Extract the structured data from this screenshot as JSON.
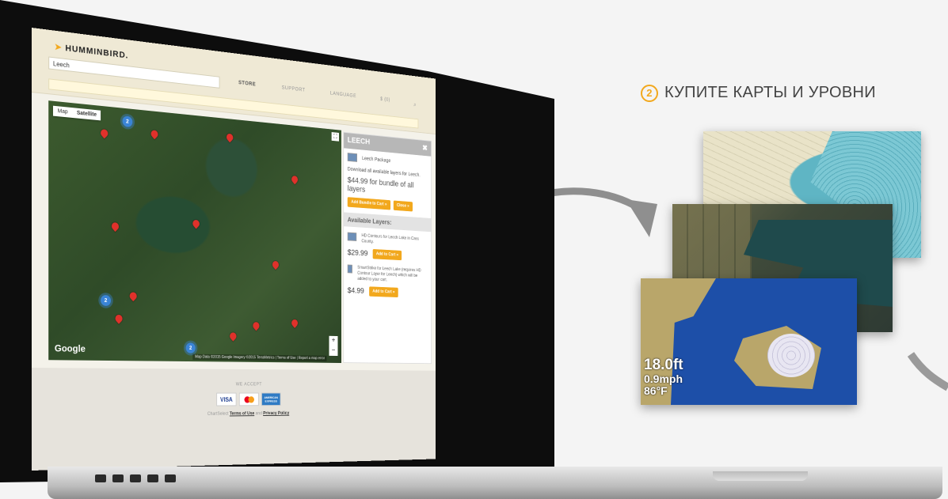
{
  "caption": {
    "number": "2",
    "text": "КУПИТЕ КАРТЫ И УРОВНИ"
  },
  "site": {
    "logo": "HUMMINBIRD.",
    "search_value": "Leech",
    "nav": [
      "STORE",
      "SUPPORT",
      "LANGUAGE",
      "$ (0)"
    ],
    "nav_search_icon": "search-icon"
  },
  "map": {
    "tabs": [
      "Map",
      "Satellite"
    ],
    "google": "Google",
    "attribution": "Map Data ©2015 Google Imagery ©2015 TerraMetrics | Terms of Use | Report a map error",
    "clusters": [
      "2",
      "2",
      "2"
    ]
  },
  "panel": {
    "title": "LEECH",
    "close_glyph": "✖",
    "package_label": "Leech Package",
    "download_text": "Download all available layers for Leech.",
    "bundle_price": "$44.99 for bundle of all layers",
    "add_bundle": "Add Bundle to Cart »",
    "close_btn": "Close »",
    "available_heading": "Available Layers:",
    "layers": [
      {
        "desc": "HD Contours for Leech Lake in Cass County.",
        "price": "$29.99",
        "button": "Add to Cart »"
      },
      {
        "desc": "SmartStrike for Leech Lake (requires HD Contour Layer for Leech) which will be added to your cart.",
        "price": "$4.99",
        "button": "Add to Cart »"
      }
    ]
  },
  "footer": {
    "we_accept": "WE ACCEPT",
    "cards": [
      "VISA",
      "MasterCard",
      "AMERICAN EXPRESS"
    ],
    "legal_prefix": "ChartSelect",
    "terms": "Terms of Use",
    "and": "and",
    "privacy": "Privacy Policy"
  },
  "chart_card": {
    "depth": "18.0ft",
    "speed": "0.9mph",
    "temp": "86°F"
  },
  "colors": {
    "accent": "#f2a81d",
    "pin": "#e0312b",
    "cluster": "#3a84d6"
  }
}
